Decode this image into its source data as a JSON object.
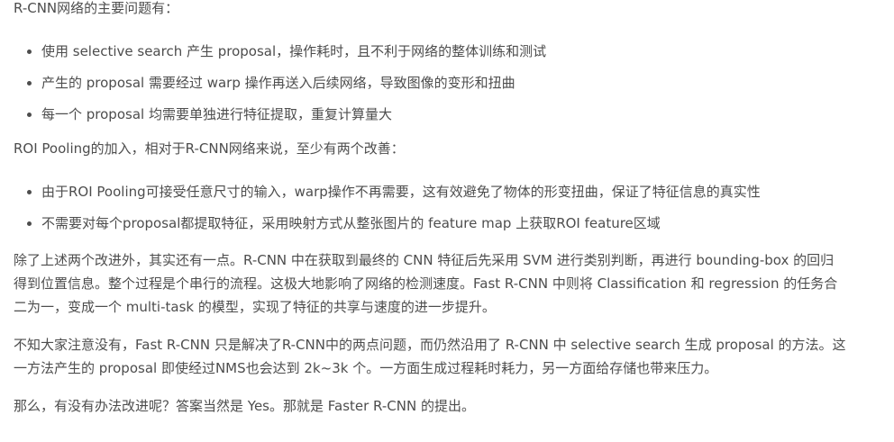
{
  "intro1": "R-CNN网络的主要问题有：",
  "list1": [
    "使用 selective search 产生 proposal，操作耗时，且不利于网络的整体训练和测试",
    "产生的 proposal 需要经过 warp 操作再送入后续网络，导致图像的变形和扭曲",
    "每一个 proposal 均需要单独进行特征提取，重复计算量大"
  ],
  "intro2": "ROI Pooling的加入，相对于R-CNN网络来说，至少有两个改善：",
  "list2": [
    "由于ROI Pooling可接受任意尺寸的输入，warp操作不再需要，这有效避免了物体的形变扭曲，保证了特征信息的真实性",
    "不需要对每个proposal都提取特征，采用映射方式从整张图片的 feature map 上获取ROI feature区域"
  ],
  "para1_lines": [
    "除了上述两个改进外，其实还有一点。R-CNN 中在获取到最终的 CNN 特征后先采用 SVM 进行类别判断，再进行 bounding-box 的回归",
    "得到位置信息。整个过程是个串行的流程。这极大地影响了网络的检测速度。Fast R-CNN 中则将 Classification 和 regression 的任务合",
    "二为一，变成一个 multi-task 的模型，实现了特征的共享与速度的进一步提升。"
  ],
  "para2_lines": [
    "不知大家注意没有，Fast R-CNN 只是解决了R-CNN中的两点问题，而仍然沿用了 R-CNN 中 selective search 生成 proposal 的方法。这",
    "一方法产生的 proposal 即使经过NMS也会达到 2k~3k 个。一方面生成过程耗时耗力，另一方面给存储也带来压力。"
  ],
  "para3": "那么，有没有办法改进呢？答案当然是 Yes。那就是 Faster R-CNN 的提出。"
}
